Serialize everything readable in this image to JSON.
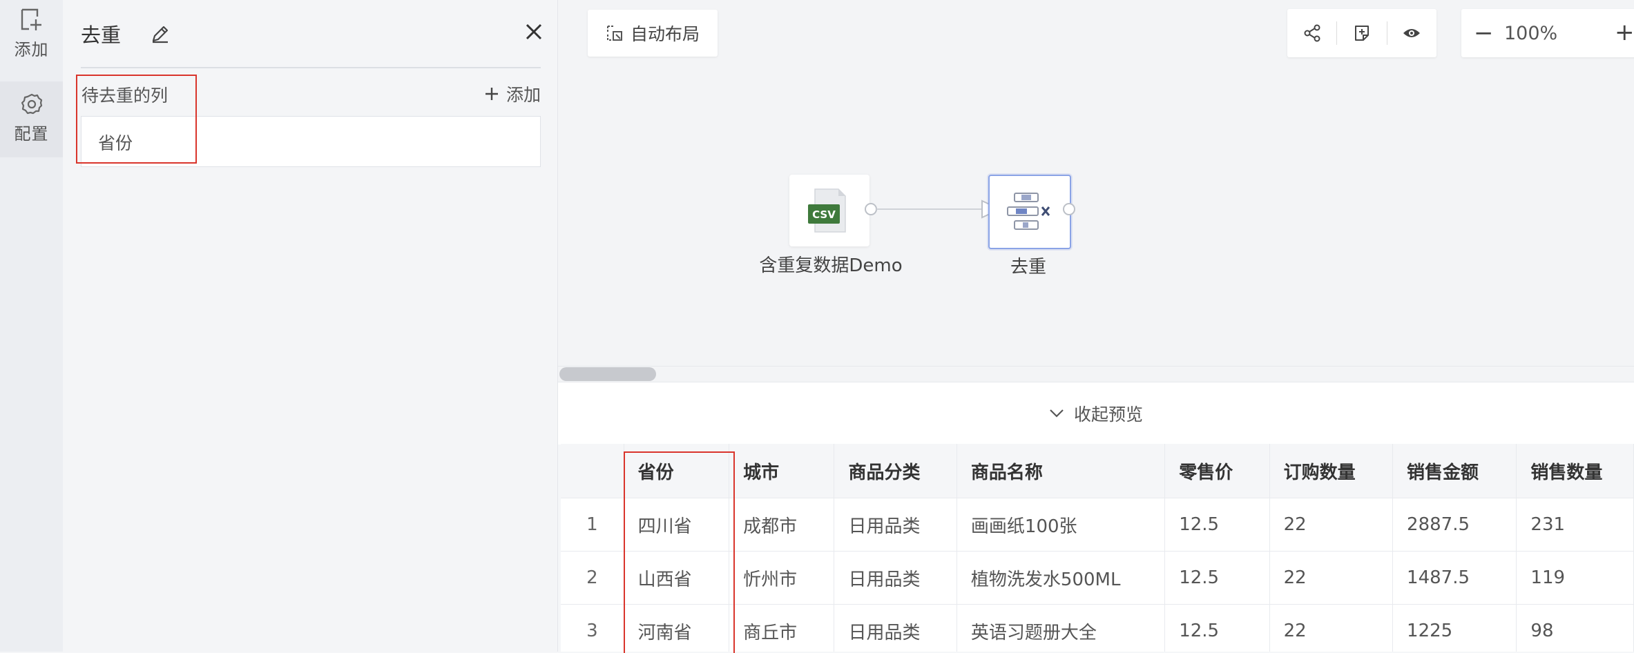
{
  "rail": {
    "add_label": "添加",
    "config_label": "配置"
  },
  "panel": {
    "title": "去重",
    "section_label": "待去重的列",
    "add_link": "添加",
    "columns": [
      "省份"
    ]
  },
  "canvas": {
    "auto_layout_label": "自动布局",
    "zoom_value": "100%",
    "zoom_minus": "−",
    "zoom_plus": "+",
    "nodes": {
      "source": {
        "label": "含重复数据Demo",
        "badge": "CSV"
      },
      "dedupe": {
        "label": "去重"
      }
    }
  },
  "preview": {
    "collapse_label": "收起预览",
    "headers": [
      "",
      "省份",
      "城市",
      "商品分类",
      "商品名称",
      "零售价",
      "订购数量",
      "销售金额",
      "销售数量"
    ],
    "rows": [
      [
        "1",
        "四川省",
        "成都市",
        "日用品类",
        "画画纸100张",
        "12.5",
        "22",
        "2887.5",
        "231"
      ],
      [
        "2",
        "山西省",
        "忻州市",
        "日用品类",
        "植物洗发水500ML",
        "12.5",
        "22",
        "1487.5",
        "119"
      ],
      [
        "3",
        "河南省",
        "商丘市",
        "日用品类",
        "英语习题册大全",
        "12.5",
        "22",
        "1225",
        "98"
      ]
    ]
  },
  "colors": {
    "highlight": "#d9342b",
    "csv_green": "#3f7a3c",
    "node_selected_border": "#8aa3e6"
  }
}
